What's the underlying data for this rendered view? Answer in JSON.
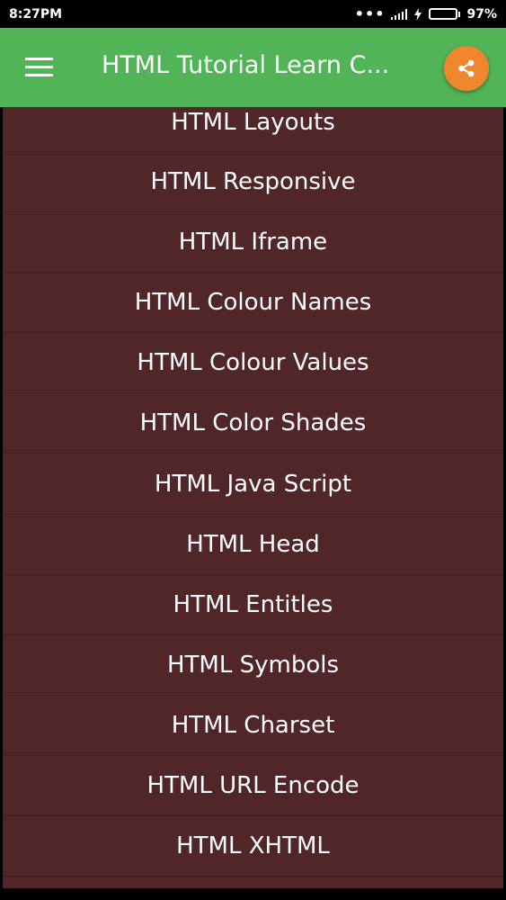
{
  "status_bar": {
    "time": "8:27PM",
    "dots": "•••",
    "battery_percent": "97%",
    "battery_level": 0.97,
    "battery_color": "#2ecc40"
  },
  "app_bar": {
    "title": "HTML Tutorial Learn C...",
    "menu_icon": "hamburger-menu-icon",
    "share_icon": "share-icon",
    "background_color": "#51b456",
    "share_button_color": "#f0862e"
  },
  "topics": [
    {
      "label": "HTML Layouts"
    },
    {
      "label": "HTML Responsive"
    },
    {
      "label": "HTML Iframe"
    },
    {
      "label": "HTML Colour Names"
    },
    {
      "label": "HTML Colour Values"
    },
    {
      "label": "HTML Color Shades"
    },
    {
      "label": "HTML Java Script"
    },
    {
      "label": "HTML Head"
    },
    {
      "label": "HTML Entitles"
    },
    {
      "label": "HTML Symbols"
    },
    {
      "label": "HTML Charset"
    },
    {
      "label": "HTML URL Encode"
    },
    {
      "label": "HTML XHTML"
    }
  ],
  "list_background_color": "#512628"
}
